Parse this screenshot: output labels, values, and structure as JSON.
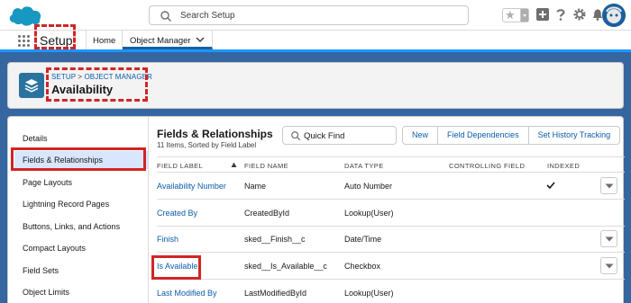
{
  "header": {
    "logo": "salesforce-cloud-logo",
    "search_placeholder": "Search Setup",
    "icons": [
      "star-icon",
      "plus-icon",
      "help-icon",
      "gear-icon",
      "bell-icon",
      "avatar"
    ]
  },
  "nav": {
    "app_name": "Setup",
    "tabs": [
      {
        "label": "Home"
      },
      {
        "label": "Object Manager"
      }
    ]
  },
  "page_header": {
    "breadcrumb_setup": "SETUP",
    "breadcrumb_separator": ">",
    "breadcrumb_object_manager": "OBJECT MANAGER",
    "title": "Availability"
  },
  "sidebar": {
    "items": [
      {
        "label": "Details"
      },
      {
        "label": "Fields & Relationships"
      },
      {
        "label": "Page Layouts"
      },
      {
        "label": "Lightning Record Pages"
      },
      {
        "label": "Buttons, Links, and Actions"
      },
      {
        "label": "Compact Layouts"
      },
      {
        "label": "Field Sets"
      },
      {
        "label": "Object Limits"
      }
    ]
  },
  "content": {
    "title": "Fields & Relationships",
    "subtitle": "11 Items, Sorted by Field Label",
    "quick_find_placeholder": "Quick Find",
    "buttons": {
      "new": "New",
      "field_dependencies": "Field Dependencies",
      "set_history_tracking": "Set History Tracking"
    },
    "columns": {
      "field_label": "FIELD LABEL",
      "field_name": "FIELD NAME",
      "data_type": "DATA TYPE",
      "controlling_field": "CONTROLLING FIELD",
      "indexed": "INDEXED"
    },
    "rows": [
      {
        "label": "Availability Number",
        "name": "Name",
        "type": "Auto Number",
        "controlling": "",
        "indexed": true,
        "menu": true
      },
      {
        "label": "Created By",
        "name": "CreatedById",
        "type": "Lookup(User)",
        "controlling": "",
        "indexed": false,
        "menu": false
      },
      {
        "label": "Finish",
        "name": "sked__Finish__c",
        "type": "Date/Time",
        "controlling": "",
        "indexed": false,
        "menu": true
      },
      {
        "label": "Is Available",
        "name": "sked__Is_Available__c",
        "type": "Checkbox",
        "controlling": "",
        "indexed": false,
        "menu": true
      },
      {
        "label": "Last Modified By",
        "name": "LastModifiedById",
        "type": "Lookup(User)",
        "controlling": "",
        "indexed": false,
        "menu": false
      }
    ]
  },
  "colors": {
    "background": "#3566a0",
    "link": "#0b5cab",
    "highlight_box": "#d12525",
    "active_nav": "#d8e6fe",
    "object_icon": "#2a739e"
  }
}
